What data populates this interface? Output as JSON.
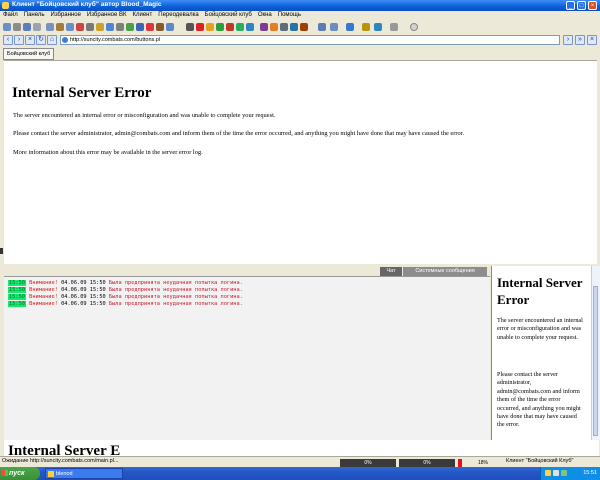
{
  "window": {
    "title": "Клиент \"Бойцовский клуб\" автор Blood_Magic"
  },
  "menu": [
    "Файл",
    "Панель",
    "Избранное",
    "Избранное ВК",
    "Клиент",
    "Переодевалка",
    "Бойцовский клуб",
    "Окна",
    "Помощь"
  ],
  "address": {
    "url": "http://suncity.combats.com/buttons.pl"
  },
  "tabs": [
    {
      "label": "Бойцовский клуб"
    }
  ],
  "error_page": {
    "title": "Internal Server Error",
    "p1": "The server encountered an internal error or misconfiguration and was unable to complete your request.",
    "p2": "Please contact the server administrator, admin@combats.com and inform them of the time the error occurred, and anything you might have done that may have caused the error.",
    "p3": "More information about this error may be available in the server error log."
  },
  "chat": {
    "tabs": [
      "Чат",
      "Системные сообщения"
    ],
    "lines": [
      {
        "time": "15:50",
        "label": "Внимание!",
        "date": "04.06.09 15:50",
        "text": "Была предпринята неудачная попытка логина."
      },
      {
        "time": "15:50",
        "label": "Внимание!",
        "date": "04.06.09 15:50",
        "text": "Была предпринята неудачная попытка логина."
      },
      {
        "time": "15:50",
        "label": "Внимание!",
        "date": "04.06.09 15:50",
        "text": "Была предпринята неудачная попытка логина."
      },
      {
        "time": "15:50",
        "label": "Внимание!",
        "date": "04.06.09 15:50",
        "text": "Была предпринята неудачная попытка логина."
      }
    ]
  },
  "side_error": {
    "title": "Internal Server Error",
    "p1": "The server encountered an internal error or misconfiguration and was unable to complete your request.",
    "p2": "Please contact the server administrator, admin@combats.com and inform them of the time the error occurred, and anything you might have done that may have caused the error."
  },
  "bottom_frame": {
    "partial_title": "Internal Server E"
  },
  "status": {
    "loading": "Ожидание http://suncity.combats.com/main.pl...",
    "bar1": "0%",
    "bar2": "0%",
    "bar3": "18%",
    "client": "Клиент \"Бойцовский Клуб\""
  },
  "taskbar": {
    "start": "пуск",
    "task": "blenod",
    "clock": "15:51"
  }
}
